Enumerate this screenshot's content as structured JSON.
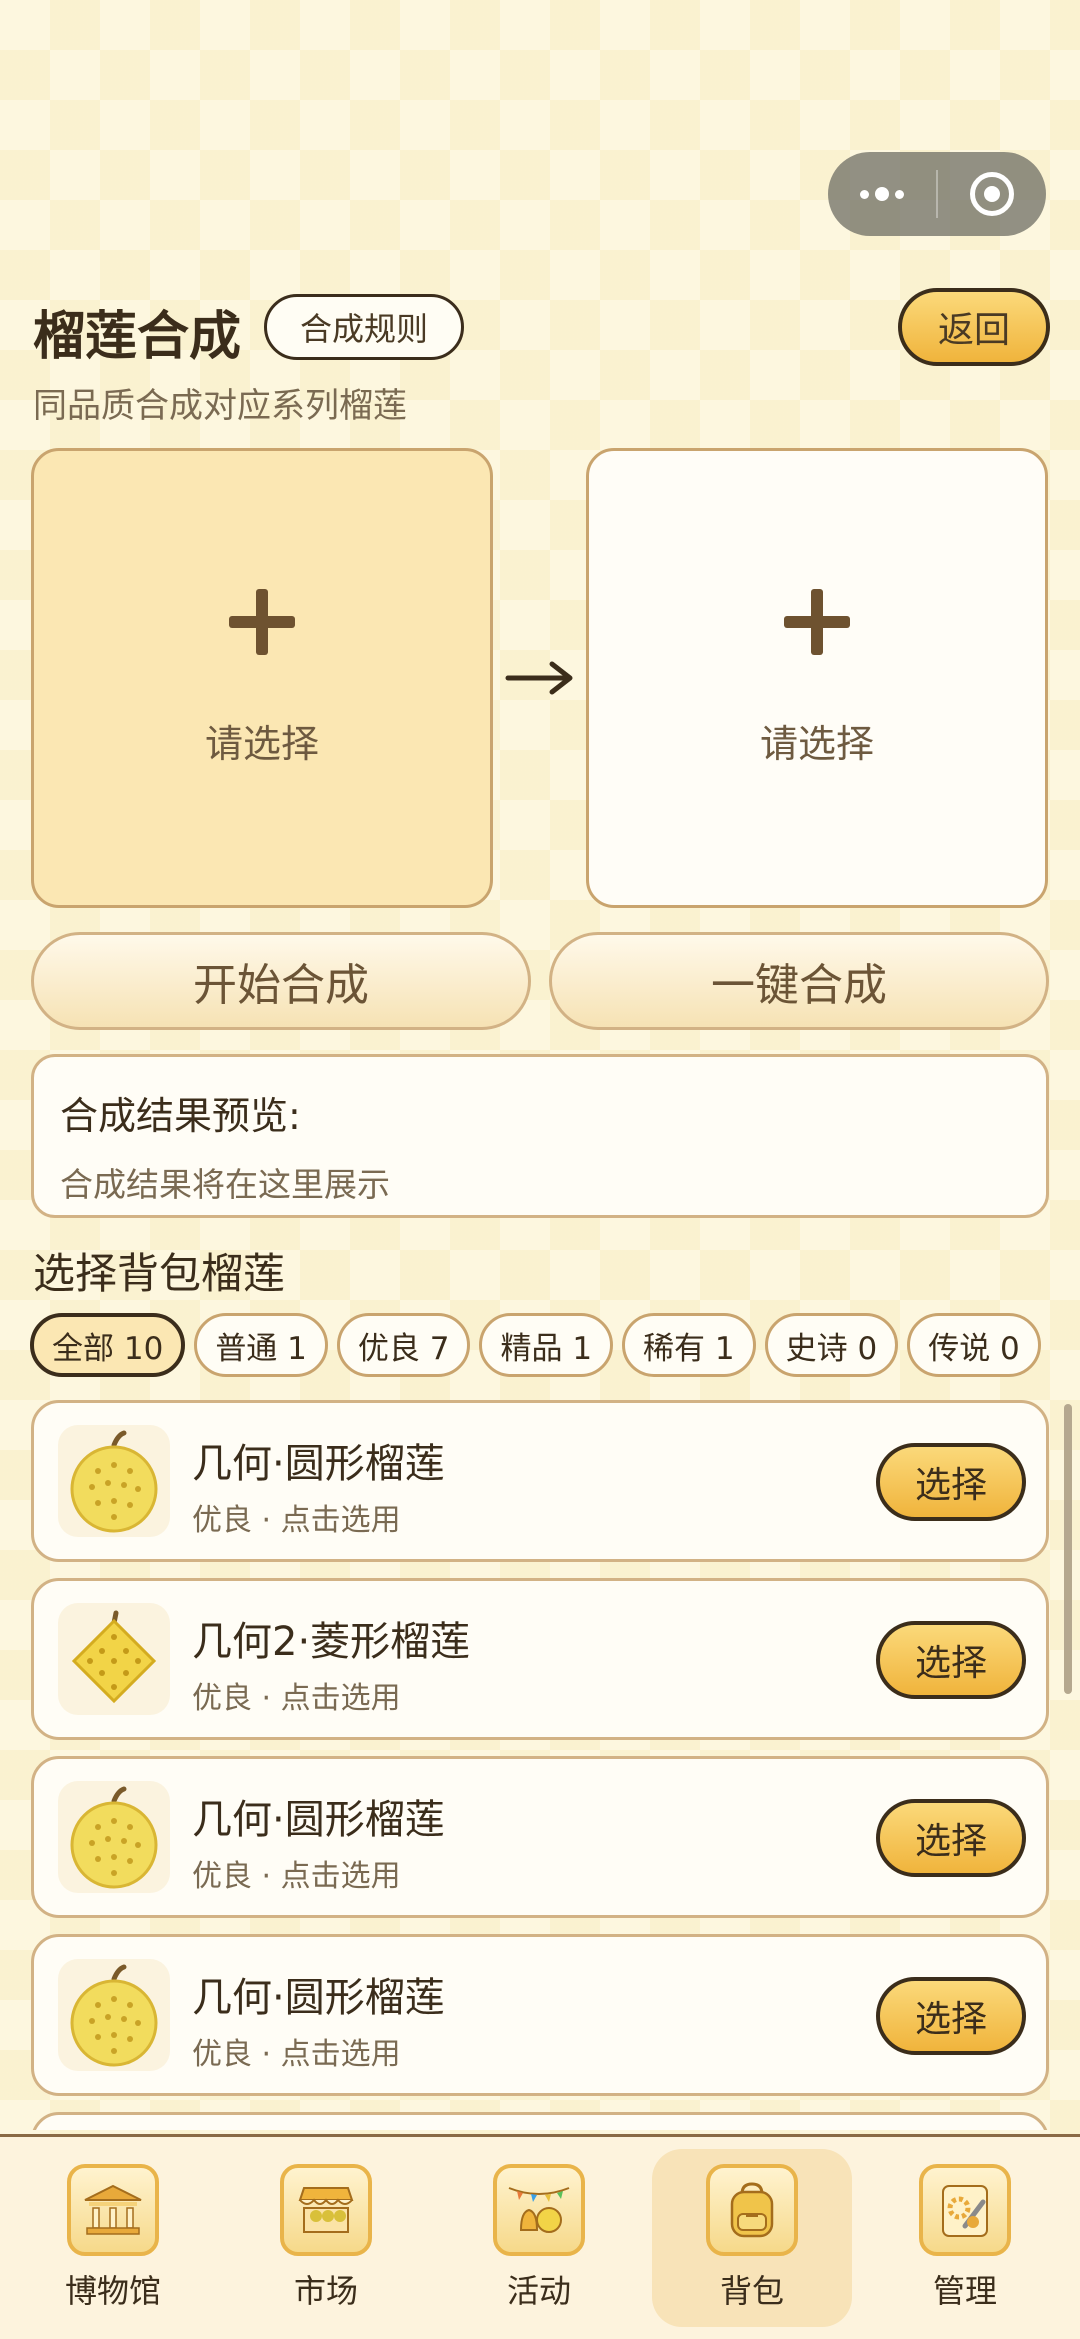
{
  "header": {
    "title": "榴莲合成",
    "rules_label": "合成规则",
    "back_label": "返回",
    "subtitle": "同品质合成对应系列榴莲"
  },
  "slots": {
    "left_label": "请选择",
    "right_label": "请选择"
  },
  "actions": {
    "start_label": "开始合成",
    "auto_label": "一键合成"
  },
  "preview": {
    "title": "合成结果预览:",
    "text": "合成结果将在这里展示"
  },
  "section_title": "选择背包榴莲",
  "filters": [
    {
      "label": "全部 10",
      "active": true
    },
    {
      "label": "普通 1"
    },
    {
      "label": "优良 7"
    },
    {
      "label": "精品 1"
    },
    {
      "label": "稀有 1"
    },
    {
      "label": "史诗 0"
    },
    {
      "label": "传说 0"
    }
  ],
  "items": [
    {
      "name": "几何·圆形榴莲",
      "desc": "优良 · 点击选用",
      "button": "选择",
      "icon": "round-durian-icon"
    },
    {
      "name": "几何2·菱形榴莲",
      "desc": "优良 · 点击选用",
      "button": "选择",
      "icon": "diamond-durian-icon"
    },
    {
      "name": "几何·圆形榴莲",
      "desc": "优良 · 点击选用",
      "button": "选择",
      "icon": "round-durian-icon"
    },
    {
      "name": "几何·圆形榴莲",
      "desc": "优良 · 点击选用",
      "button": "选择",
      "icon": "round-durian-icon"
    }
  ],
  "tabs": [
    {
      "label": "博物馆",
      "icon": "museum-icon"
    },
    {
      "label": "市场",
      "icon": "market-icon"
    },
    {
      "label": "活动",
      "icon": "activity-icon"
    },
    {
      "label": "背包",
      "icon": "backpack-icon",
      "active": true
    },
    {
      "label": "管理",
      "icon": "manage-icon"
    }
  ],
  "colors": {
    "accent": "#f0b43c",
    "border": "#c9a46e",
    "text": "#3b2d1b"
  }
}
